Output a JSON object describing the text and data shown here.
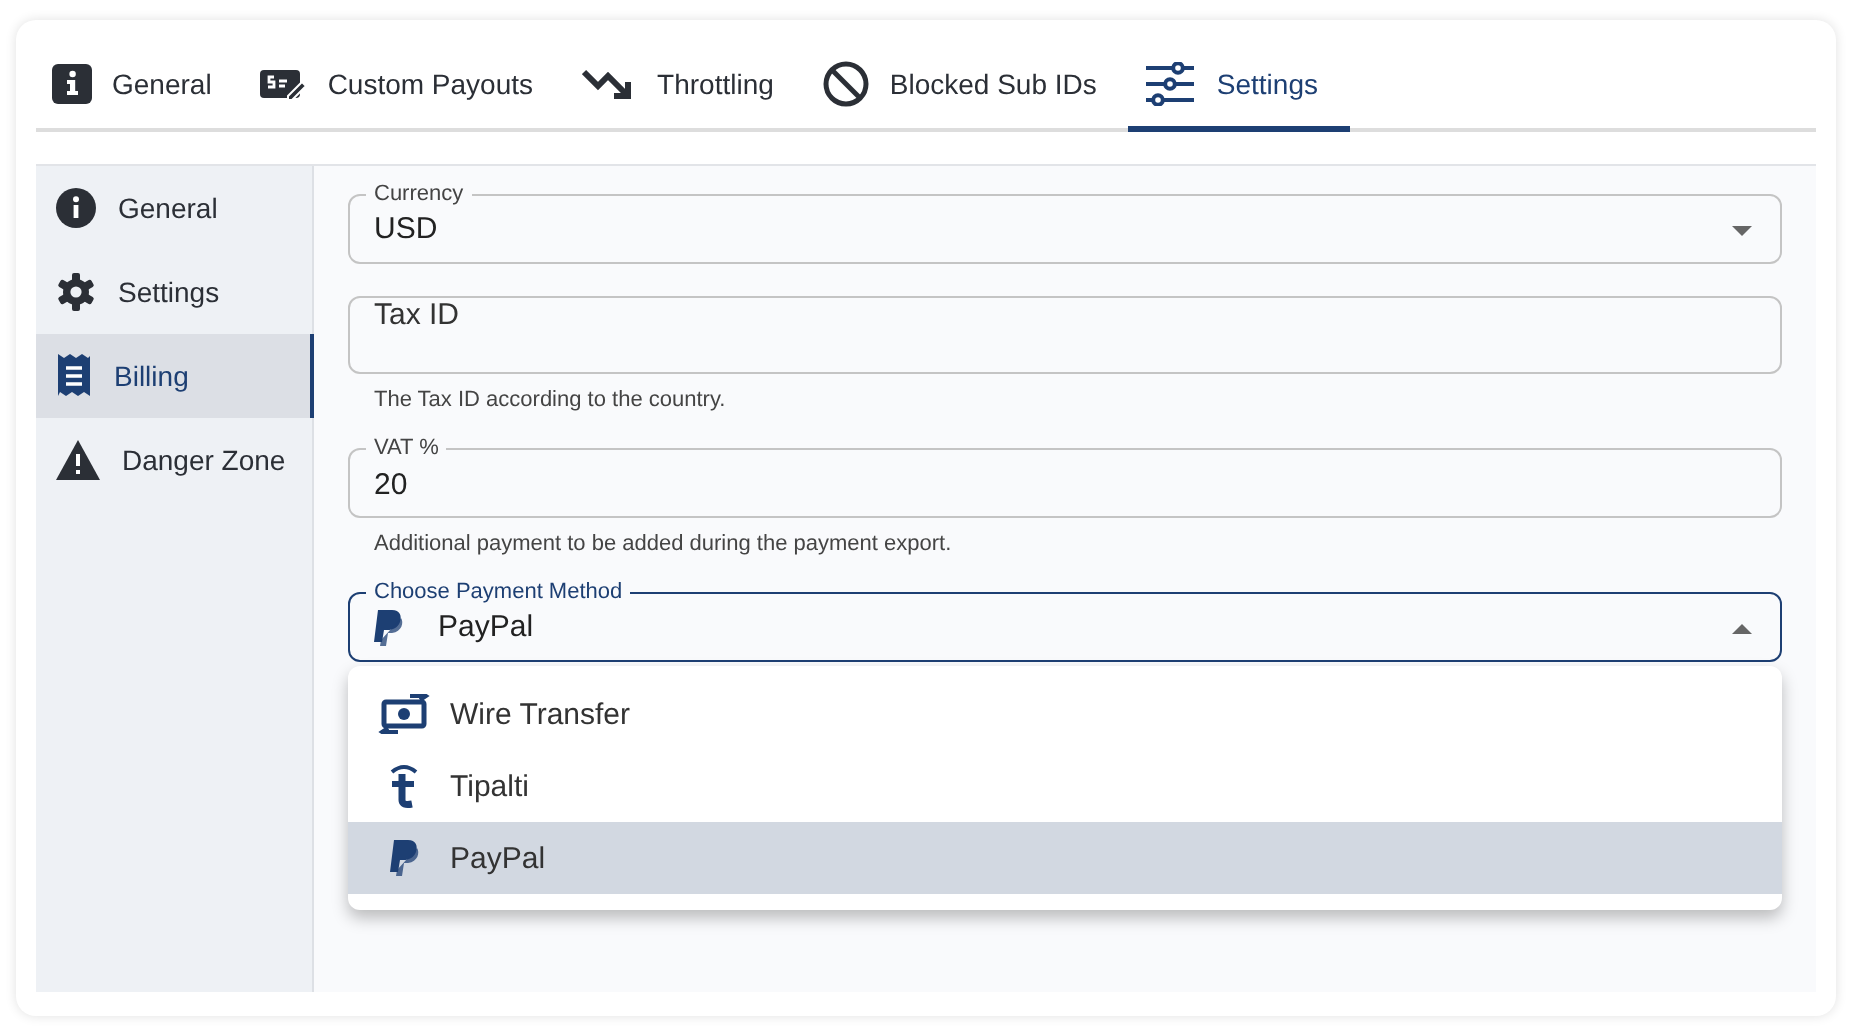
{
  "tabs": [
    {
      "label": "General",
      "kind": "info",
      "selected": false
    },
    {
      "label": "Custom Payouts",
      "kind": "payouts",
      "selected": false
    },
    {
      "label": "Throttling",
      "kind": "throttle",
      "selected": false
    },
    {
      "label": "Blocked Sub IDs",
      "kind": "blocked",
      "selected": false
    },
    {
      "label": "Settings",
      "kind": "sliders",
      "selected": true
    }
  ],
  "sidebar": {
    "items": [
      {
        "label": "General",
        "kind": "info",
        "selected": false
      },
      {
        "label": "Settings",
        "kind": "gear",
        "selected": false
      },
      {
        "label": "Billing",
        "kind": "receipt",
        "selected": true
      },
      {
        "label": "Danger Zone",
        "kind": "warning",
        "selected": false
      }
    ]
  },
  "form": {
    "currency": {
      "label": "Currency",
      "value": "USD"
    },
    "tax_id": {
      "placeholder": "Tax ID",
      "helper": "The Tax ID according to the country."
    },
    "vat": {
      "label": "VAT %",
      "value": "20",
      "helper": "Additional payment to be added during the payment export."
    },
    "payment_method": {
      "label": "Choose Payment Method",
      "value": "PayPal",
      "kind": "paypal",
      "expanded": true,
      "options": [
        {
          "label": "Wire Transfer",
          "kind": "wire",
          "selected": false
        },
        {
          "label": "Tipalti",
          "kind": "tipalti",
          "selected": false
        },
        {
          "label": "PayPal",
          "kind": "paypal",
          "selected": true
        }
      ]
    }
  }
}
